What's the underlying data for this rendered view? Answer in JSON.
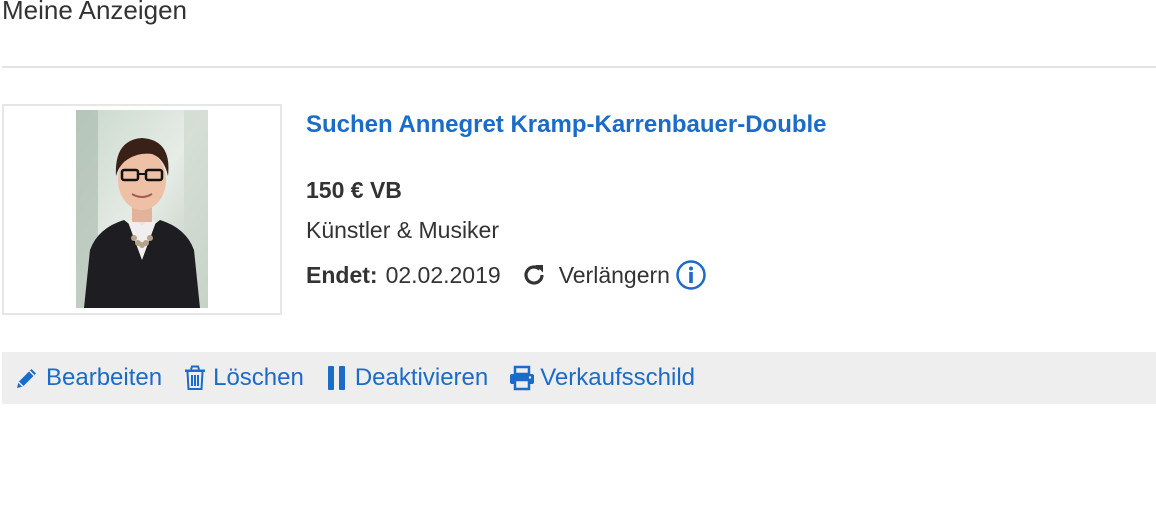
{
  "page": {
    "title": "Meine Anzeigen"
  },
  "ad": {
    "title": "Suchen Annegret Kramp-Karrenbauer-Double",
    "price": "150 € VB",
    "category": "Künstler & Musiker",
    "end_label": "Endet:",
    "end_date": "02.02.2019",
    "extend_label": "Verlängern",
    "image_alt": "Foto der Anzeige"
  },
  "actions": {
    "edit": "Bearbeiten",
    "delete": "Löschen",
    "deactivate": "Deaktivieren",
    "print": "Verkaufsschild"
  },
  "icons": {
    "edit": "pencil-icon",
    "delete": "trash-icon",
    "deactivate": "pause-icon",
    "print": "printer-icon",
    "extend": "refresh-icon",
    "info": "info-circle-icon"
  },
  "colors": {
    "link": "#1b6bc8",
    "text": "#333333",
    "action_bar_bg": "#eeeeee",
    "divider": "#e3e3e3"
  }
}
